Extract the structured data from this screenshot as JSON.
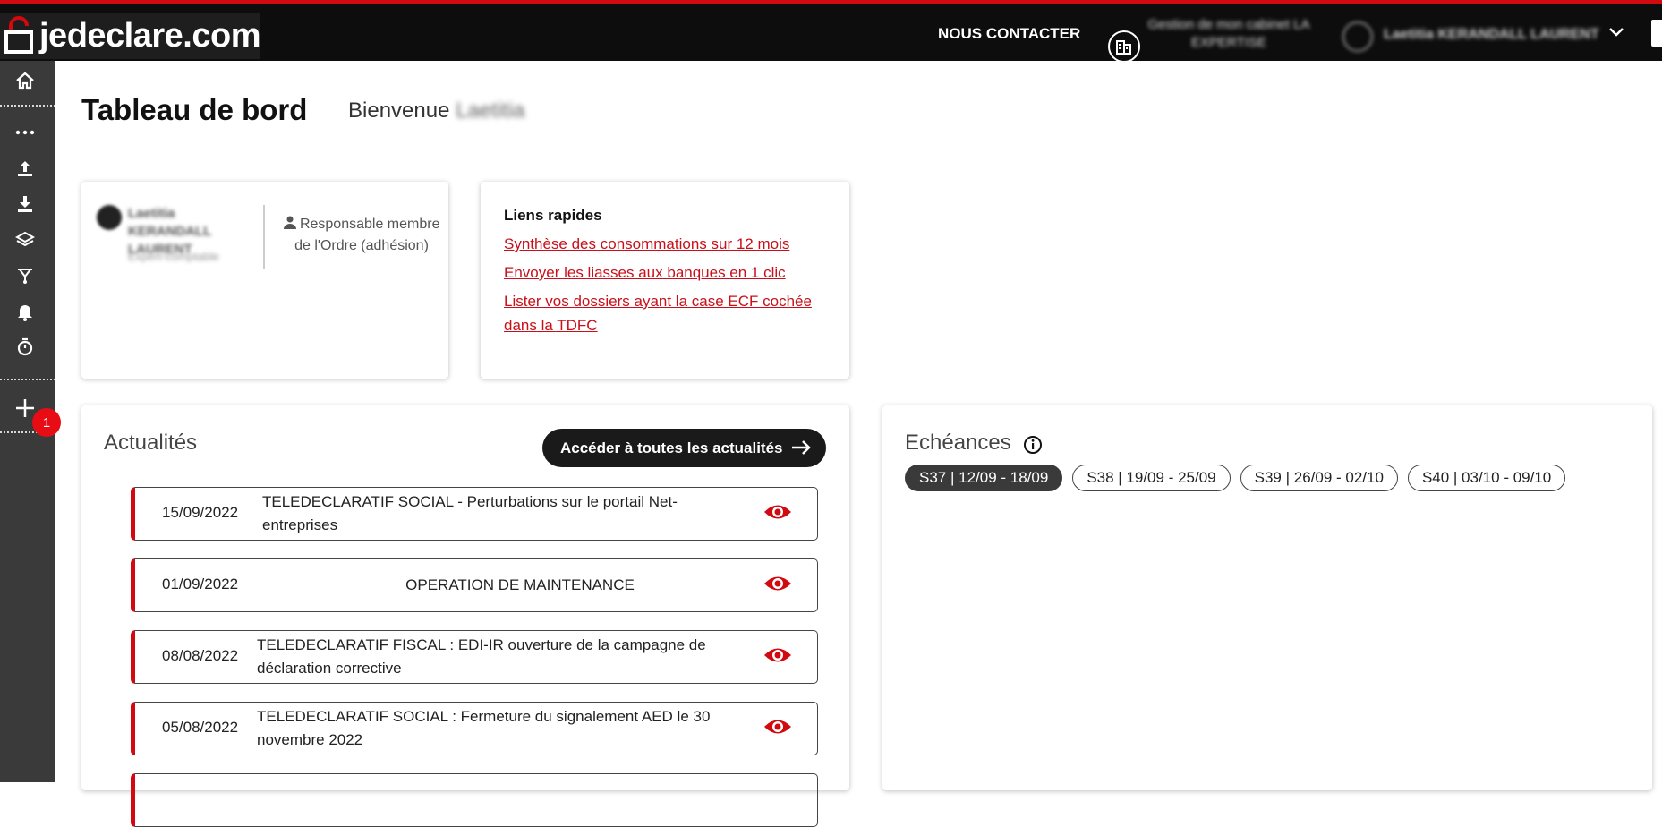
{
  "header": {
    "logo_text": "jedeclare.com",
    "contact_label": "NOUS CONTACTER",
    "cabinet_text": "Gestion de mon cabinet LA EXPERTISE",
    "user_name": "Laetitia KERANDALL LAURENT"
  },
  "sidebar": {
    "badge_count": "1",
    "items": [
      "home-icon",
      "more-icon",
      "upload-icon",
      "download-icon",
      "layers-icon",
      "network-icon",
      "bell-icon",
      "timer-icon",
      "plus-icon"
    ]
  },
  "page": {
    "title": "Tableau de bord",
    "welcome_label": "Bienvenue",
    "welcome_name": "Laetitia"
  },
  "profile": {
    "name": "Laetitia KERANDALL LAURENT",
    "subtitle": "Expert-comptable",
    "role": "Responsable membre de l'Ordre (adhésion)"
  },
  "quick_links": {
    "title": "Liens rapides",
    "links": [
      "Synthèse des consommations sur 12 mois",
      "Envoyer les liasses aux banques en 1 clic",
      "Lister vos dossiers ayant la case ECF cochée dans la TDFC"
    ]
  },
  "news": {
    "title": "Actualités",
    "button_label": "Accéder à toutes les actualités",
    "items": [
      {
        "date": "15/09/2022",
        "text": "TELEDECLARATIF SOCIAL - Perturbations sur le portail Net-entreprises"
      },
      {
        "date": "01/09/2022",
        "text": "OPERATION DE MAINTENANCE"
      },
      {
        "date": "08/08/2022",
        "text": "TELEDECLARATIF FISCAL : EDI-IR ouverture de la campagne de déclaration corrective"
      },
      {
        "date": "05/08/2022",
        "text": "TELEDECLARATIF SOCIAL : Fermeture du signalement AED le 30 novembre 2022"
      }
    ]
  },
  "echeances": {
    "title": "Echéances",
    "weeks": [
      "S37 | 12/09 - 18/09",
      "S38 | 19/09 - 25/09",
      "S39 | 26/09 - 02/10",
      "S40 | 03/10 - 09/10"
    ],
    "active_week": "S37 | 12/09 - 18/09"
  },
  "colors": {
    "accent": "#d10a10",
    "topbar": "#0d0d0d",
    "sidebar": "#3a3a3a"
  }
}
